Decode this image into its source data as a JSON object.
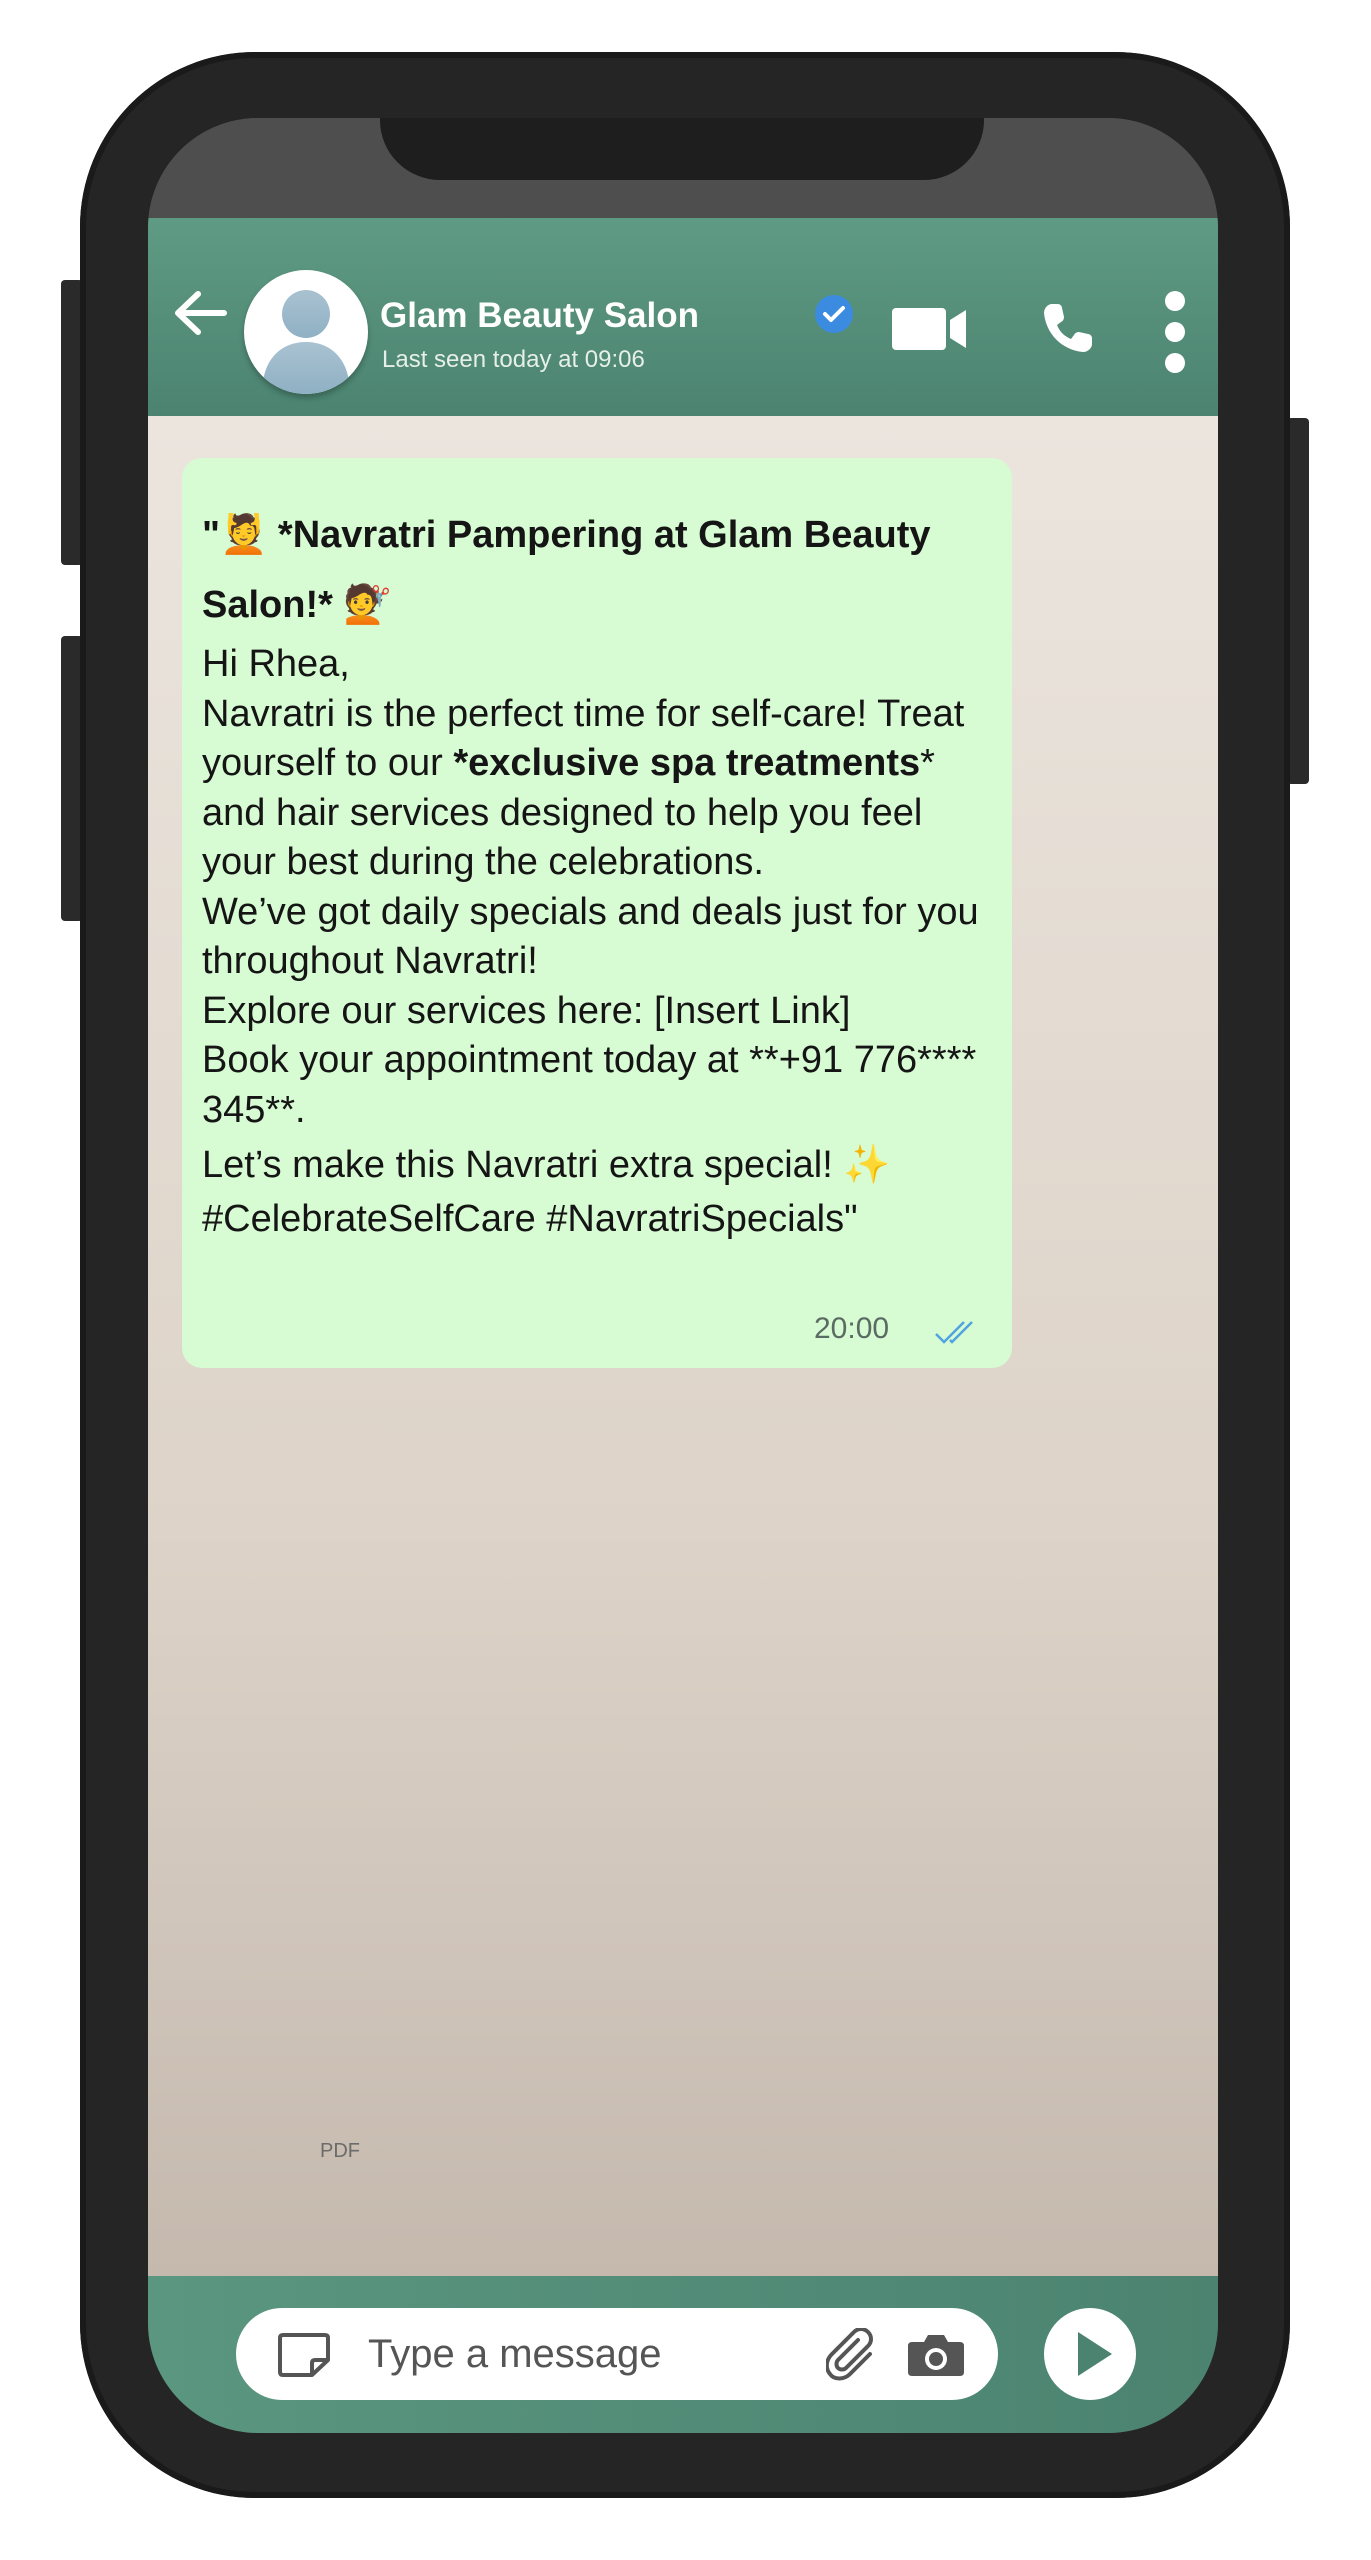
{
  "header": {
    "contact_name": "Glam Beauty Salon",
    "last_seen": "Last seen today at 09:06",
    "icons": [
      "back-arrow-icon",
      "avatar",
      "verified-badge-icon",
      "video-call-icon",
      "phone-call-icon",
      "more-options-icon"
    ]
  },
  "message": {
    "title_quote": "\"",
    "title_text_1": " *Navratri Pampering at Glam Beauty Salon!* ",
    "emoji_1": "💆",
    "emoji_2": "💇",
    "greeting": "Hi Rhea,",
    "para_1a": "Navratri is the perfect time for self-care! Treat yourself to our ",
    "para_1b": "*exclusive spa treatments",
    "para_1c": "* and hair services designed to help you feel your best during the celebrations.",
    "para_2": "We’ve got daily specials and deals just for you throughout Navratri!",
    "para_3": "Explore our services here: [Insert Link]",
    "para_4": "Book your appointment today at **+91 776**** 345**.",
    "para_5": "Let’s make this Navratri extra special! ",
    "emoji_3": "✨",
    "hashtags": "#CelebrateSelfCare #NavratriSpecials\"",
    "time": "20:00",
    "status": "read"
  },
  "chat_background_label": "PDF",
  "composer": {
    "placeholder": "Type a message"
  },
  "colors": {
    "header": "#5f9b84",
    "bubble": "#d7fbd2",
    "read_ticks": "#4fa3e0",
    "verified": "#3b8be0"
  }
}
